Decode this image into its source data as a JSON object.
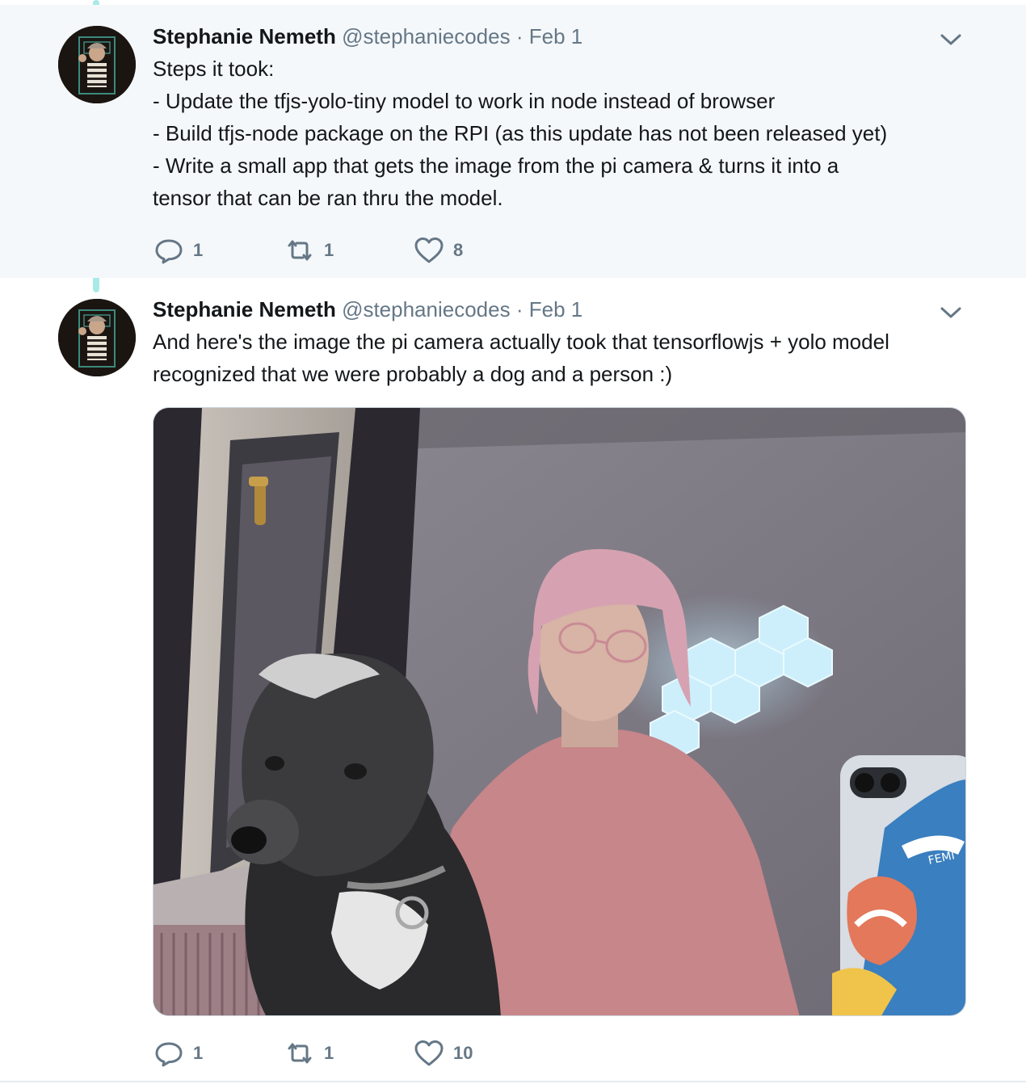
{
  "tweets": [
    {
      "author": "Stephanie Nemeth",
      "handle": "@stephaniecodes",
      "separator": "·",
      "date": "Feb 1",
      "text": "Steps it took:\n- Update the tfjs-yolo-tiny model to work in node instead of browser\n- Build tfjs-node package on the RPI (as this update has not been released yet)\n- Write a small app that gets the image from the pi camera & turns it into a\ntensor that can be ran thru the model.",
      "replies": "1",
      "retweets": "1",
      "likes": "8"
    },
    {
      "author": "Stephanie Nemeth",
      "handle": "@stephaniecodes",
      "separator": "·",
      "date": "Feb 1",
      "text": "And here's the image the pi camera actually took that tensorflowjs + yolo model\nrecognized that we were probably a dog and a person :)",
      "replies": "1",
      "retweets": "1",
      "likes": "10",
      "media_sticker_text": "FEMI"
    }
  ],
  "colors": {
    "thread_line": "#a8eae6",
    "highlight_bg": "#f5f8fa",
    "secondary_text": "#657786",
    "primary_text": "#14171a"
  },
  "icons": {
    "reply": "reply-icon",
    "retweet": "retweet-icon",
    "like": "heart-icon",
    "menu": "chevron-down-icon"
  }
}
